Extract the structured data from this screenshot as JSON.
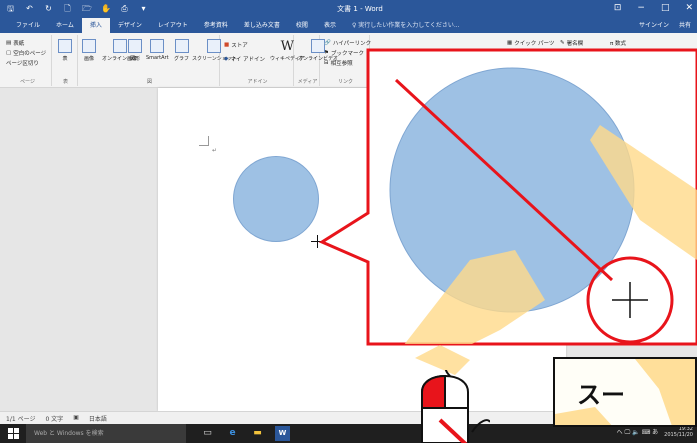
{
  "window": {
    "title": "文書 1 - Word",
    "controls": {
      "restore": "⊡",
      "minimize": "−",
      "maximize": "□",
      "close": "✕"
    }
  },
  "qat": {
    "save": "🖫",
    "undo": "↶",
    "redo": "↻",
    "new": "🗋",
    "open": "🗁",
    "touch": "✋",
    "print": "⎙",
    "more": "▾"
  },
  "tabs": [
    {
      "label": "ファイル",
      "active": false
    },
    {
      "label": "ホーム",
      "active": false
    },
    {
      "label": "挿入",
      "active": true
    },
    {
      "label": "デザイン",
      "active": false
    },
    {
      "label": "レイアウト",
      "active": false
    },
    {
      "label": "参考資料",
      "active": false
    },
    {
      "label": "差し込み文書",
      "active": false
    },
    {
      "label": "校閲",
      "active": false
    },
    {
      "label": "表示",
      "active": false
    }
  ],
  "tellme": "♀ 実行したい作業を入力してください...",
  "account": {
    "signin": "サインイン",
    "share": "共有"
  },
  "ribbon": {
    "pages": {
      "cover": "表紙",
      "blank": "空白のページ",
      "break": "ページ区切り",
      "label": "ページ"
    },
    "tables": {
      "table": "表",
      "label": "表"
    },
    "illustrations": {
      "picture": "画像",
      "online_picture": "オンライン画像",
      "shapes": "図形",
      "smartart": "SmartArt",
      "chart": "グラフ",
      "screenshot": "スクリーンショット",
      "label": "図"
    },
    "addins": {
      "store": "ストア",
      "my_addins": "マイ アドイン",
      "wiki": "ウィキペディア",
      "label": "アドイン"
    },
    "media": {
      "online_video": "オンラインビデオ",
      "label": "メディア"
    },
    "links": {
      "hyperlink": "ハイパーリンク",
      "bookmark": "ブックマーク",
      "crossref": "相互参照",
      "label": "リンク"
    },
    "text": {
      "quickparts": "クイック パーツ",
      "signature": "署名欄",
      "equation": "π 数式"
    }
  },
  "document": {
    "para_mark": "↵"
  },
  "status": {
    "page": "1/1 ページ",
    "words": "0 文字",
    "lang": "日本語"
  },
  "taskbar": {
    "search": "Web と Windows を検索",
    "time": "19:32",
    "date": "2015/11/20",
    "tray": "へ 🖵 🔈 ⌨ あ"
  },
  "annotation": {
    "sub_text": "スー"
  },
  "colors": {
    "brand": "#2b579a",
    "shape_fill": "#9ec1e4",
    "annotation_red": "#e8141b",
    "highlight_orange": "#ffd98a"
  }
}
